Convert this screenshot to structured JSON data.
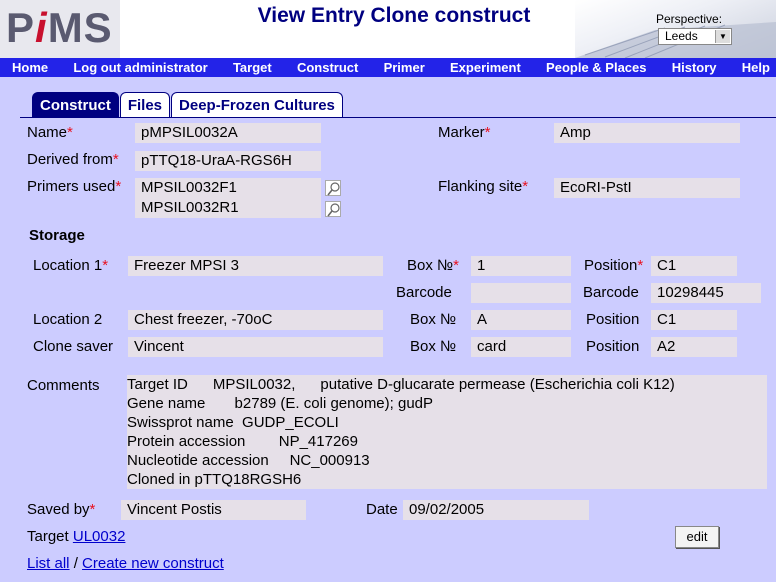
{
  "header": {
    "logo_text_left": "P",
    "logo_text_i": "i",
    "logo_text_right": "MS",
    "title": "View Entry Clone construct",
    "perspective_label": "Perspective:",
    "perspective_value": "Leeds"
  },
  "nav": {
    "items": [
      "Home",
      "Log out administrator",
      "Target",
      "Construct",
      "Primer",
      "Experiment",
      "People & Places",
      "History",
      "Help"
    ]
  },
  "tabs": {
    "items": [
      "Construct",
      "Files",
      "Deep-Frozen Cultures"
    ],
    "active": "Construct"
  },
  "fields": {
    "name_label": "Name",
    "name_value": "pMPSIL0032A",
    "marker_label": "Marker",
    "marker_value": "Amp",
    "derived_label": "Derived from",
    "derived_value": "pTTQ18-UraA-RGS6H",
    "primers_label": "Primers used",
    "primer1": "MPSIL0032F1",
    "primer2": "MPSIL0032R1",
    "flanking_label": "Flanking site",
    "flanking_value": "EcoRI-PstI"
  },
  "storage": {
    "heading": "Storage",
    "location1_label": "Location 1",
    "location1_value": "Freezer MPSI 3",
    "box_label": "Box №",
    "box1_value": "1",
    "position_label": "Position",
    "position1_value": "C1",
    "barcode_label": "Barcode",
    "barcode_left_value": "",
    "barcode_right_value": "10298445",
    "location2_label": "Location 2",
    "location2_value": "Chest freezer, -70oC",
    "box2_value": "A",
    "position2_value": "C1",
    "clone_saver_label": "Clone saver",
    "clone_saver_value": "Vincent",
    "box3_value": "card",
    "position3_value": "A2"
  },
  "comments": {
    "label": "Comments",
    "lines": [
      "Target ID      MPSIL0032,      putative D-glucarate permease (Escherichia coli K12)",
      "Gene name       b2789 (E. coli genome); gudP",
      "Swissprot name  GUDP_ECOLI",
      "Protein accession        NP_417269",
      "Nucleotide accession     NC_000913",
      "Cloned in pTTQ18RGSH6"
    ]
  },
  "footer": {
    "saved_by_label": "Saved by",
    "saved_by_value": "Vincent Postis",
    "date_label": "Date",
    "date_value": "09/02/2005",
    "target_label": "Target",
    "target_link": "UL0032",
    "edit_label": "edit",
    "list_all": "List all",
    "separator": "/",
    "create_new": "Create new construct"
  }
}
